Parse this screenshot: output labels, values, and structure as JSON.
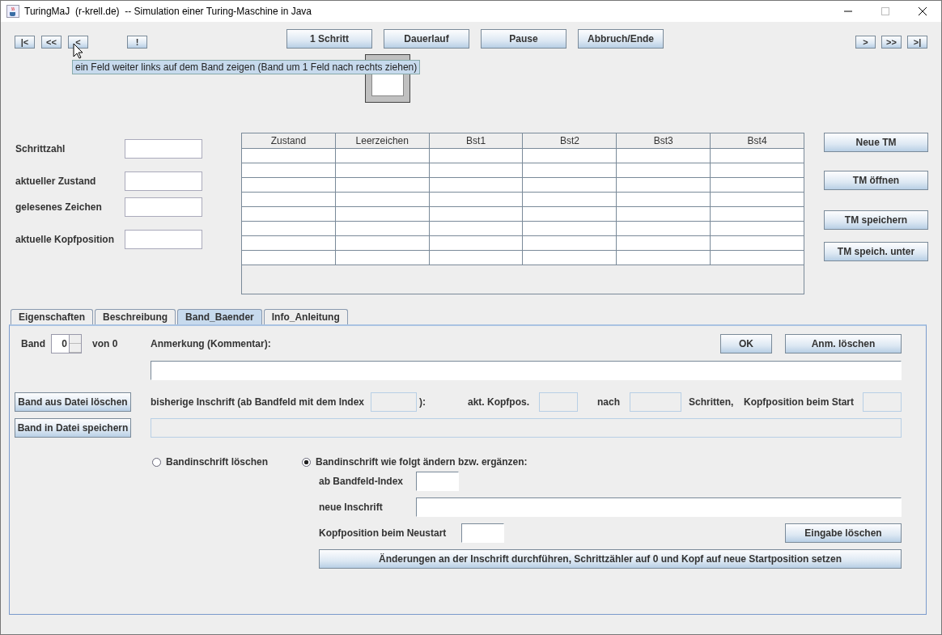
{
  "window": {
    "title": "TuringMaJ  (r-krell.de)  -- Simulation einer Turing-Maschine in Java"
  },
  "nav_left": [
    "|<",
    "<<",
    "<",
    "!"
  ],
  "run_buttons": [
    "1 Schritt",
    "Dauerlauf",
    "Pause",
    "Abbruch/Ende"
  ],
  "nav_right": [
    ">",
    ">>",
    ">|"
  ],
  "tooltip": "ein Feld weiter links auf dem Band zeigen (Band um 1 Feld nach rechts ziehen)",
  "status_fields": [
    {
      "label": "Schrittzahl"
    },
    {
      "label": "aktueller Zustand"
    },
    {
      "label": "gelesenes Zeichen"
    },
    {
      "label": "aktuelle Kopfposition"
    }
  ],
  "table": {
    "columns": [
      "Zustand",
      "Leerzeichen",
      "Bst1",
      "Bst2",
      "Bst3",
      "Bst4"
    ]
  },
  "file_buttons": [
    "Neue TM",
    "TM öffnen",
    "TM speichern",
    "TM speich. unter"
  ],
  "tabs": [
    {
      "label": "Eigenschaften",
      "selected": false
    },
    {
      "label": "Beschreibung",
      "selected": false
    },
    {
      "label": "Band_Baender",
      "selected": true
    },
    {
      "label": "Info_Anleitung",
      "selected": false
    }
  ],
  "band_panel": {
    "band_label": "Band",
    "band_value": "0",
    "band_total": "von 0",
    "comment_label": "Anmerkung (Kommentar):",
    "ok_button": "OK",
    "clear_comment_button": "Anm. löschen",
    "file_buttons": [
      "Band aus Datei löschen",
      "Band in Datei speichern"
    ],
    "history": {
      "disabled": true,
      "label_before": "bisherige Inschrift (ab Bandfeld mit dem Index",
      "label_close": "):",
      "head_label": "akt. Kopfpos.",
      "after_label": "nach",
      "steps_label": "Schritten,",
      "start_label": "Kopfposition beim Start"
    },
    "radios": [
      {
        "label": "Bandinschrift löschen",
        "selected": false
      },
      {
        "label": "Bandinschrift wie folgt ändern bzw. ergänzen:",
        "selected": true
      }
    ],
    "index_label": "ab Bandfeld-Index",
    "inscription_label": "neue Inschrift",
    "restart_label": "Kopfposition beim Neustart",
    "clear_input_button": "Eingabe löschen",
    "apply_button": "Änderungen an der Inschrift durchführen, Schrittzähler auf 0 und Kopf auf neue Startposition setzen"
  }
}
